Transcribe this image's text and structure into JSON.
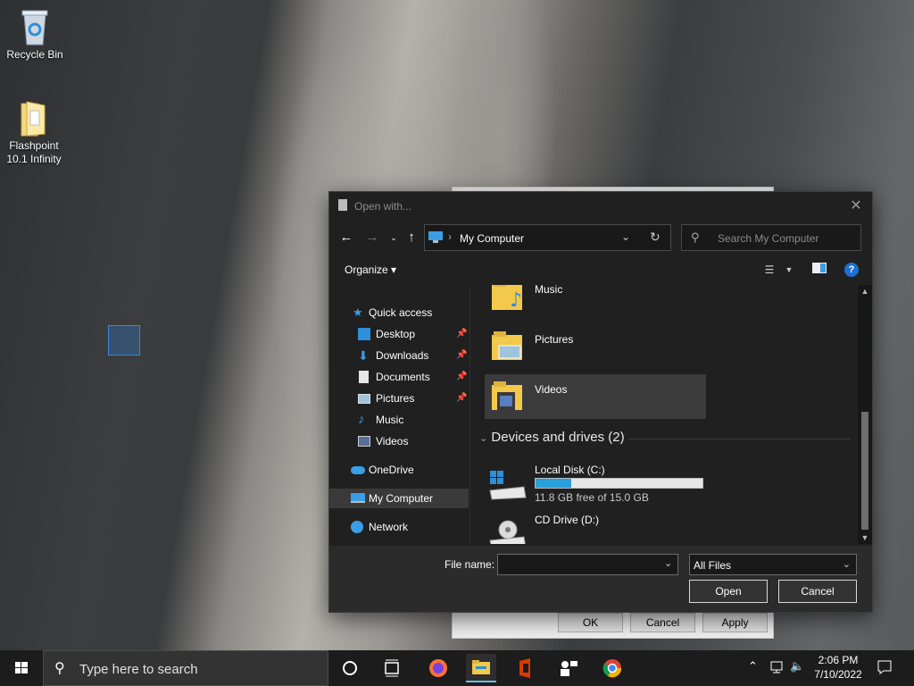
{
  "desktop": {
    "icons": [
      {
        "label_line1": "Recycle Bin",
        "label_line2": ""
      },
      {
        "label_line1": "Flashpoint",
        "label_line2": "10.1 Infinity"
      }
    ]
  },
  "back_dialog": {
    "ok": "OK",
    "cancel": "Cancel",
    "apply": "Apply"
  },
  "dialog": {
    "title": "Open with...",
    "address": {
      "location": "My Computer"
    },
    "search": {
      "placeholder": "Search My Computer"
    },
    "toolbar": {
      "organize": "Organize ▾"
    },
    "nav": {
      "quick_access": "Quick access",
      "desktop": "Desktop",
      "downloads": "Downloads",
      "documents": "Documents",
      "pictures": "Pictures",
      "music": "Music",
      "videos": "Videos",
      "onedrive": "OneDrive",
      "my_computer": "My Computer",
      "network": "Network"
    },
    "folders": [
      {
        "label": "Music"
      },
      {
        "label": "Pictures"
      },
      {
        "label": "Videos"
      }
    ],
    "group_header": "Devices and drives (2)",
    "drives": [
      {
        "label": "Local Disk (C:)",
        "free_text": "11.8 GB free of 15.0 GB",
        "used_fraction": 0.213
      },
      {
        "label": "CD Drive (D:)"
      }
    ],
    "file_name_label": "File name:",
    "file_name_value": "",
    "filter_value": "All Files",
    "open_button": "Open",
    "cancel_button": "Cancel"
  },
  "taskbar": {
    "search_placeholder": "Type here to search",
    "time": "2:06 PM",
    "date": "7/10/2022"
  },
  "colors": {
    "accent": "#26a0da",
    "dialog_bg": "#202020",
    "taskbar_bg": "#1c1c1c"
  }
}
